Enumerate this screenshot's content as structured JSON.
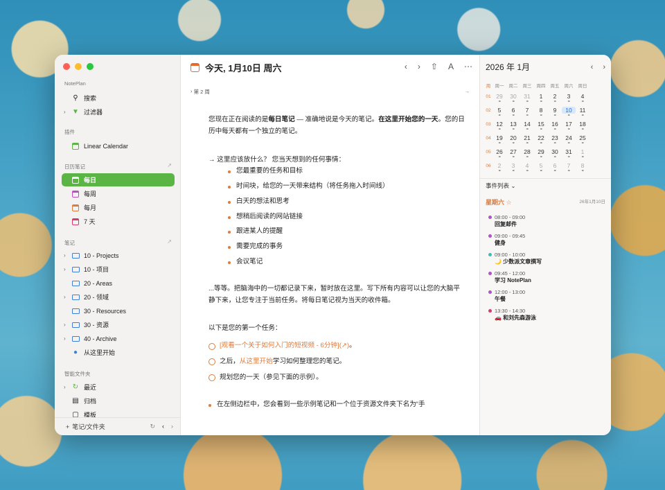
{
  "sidebar": {
    "app_name": "NotePlan",
    "search": "搜索",
    "filters": "过滤器",
    "plugins_label": "插件",
    "linear_calendar": "Linear Calendar",
    "calendar_notes_label": "日历笔记",
    "calendar_items": [
      "每日",
      "每周",
      "每月",
      "7 天"
    ],
    "notes_label": "笔记",
    "folders": [
      "10 - Projects",
      "10 - 项目",
      "20 - Areas",
      "20 - 领域",
      "30 - Resources",
      "30 - 资源",
      "40 - Archive",
      "从这里开始"
    ],
    "smart_folders_label": "智能文件夹",
    "smart_items": [
      "最近",
      "归档",
      "模板"
    ],
    "add_label": "笔记/文件夹"
  },
  "main": {
    "title": "今天, 1月10日 周六",
    "week": "第 2 周",
    "intro_1": "您现在正在阅读的是",
    "intro_bold_1": "每日笔记",
    "intro_2": " — 准确地说是今天的笔记。",
    "intro_bold_2": "在这里开始您的一天",
    "intro_3": "。您的日历中每天都有一个独立的笔记。",
    "question": "→ 这里应该放什么？ 您当天想到的任何事情：",
    "bullets": [
      "您最重要的任务和目标",
      "时间块，给您的一天带来结构（将任务拖入时间线）",
      "白天的想法和思考",
      "想稍后阅读的网站链接",
      "跟进某人的提醒",
      "需要完成的事务",
      "会议笔记"
    ],
    "paragraph": "...等等。把脑海中的一切都记录下来，暂时放在这里。写下所有内容可以让您的大脑平静下来，让您专注于当前任务。将每日笔记视为当天的收件箱。",
    "first_task_label": "以下是您的第一个任务：",
    "task1_link": "[观看一个关于如何入门的短视频 - 6分钟](↗)",
    "task1_end": "。",
    "task2_a": "之后，",
    "task2_link": "从这里开始",
    "task2_b": "学习如何整理您的笔记。",
    "task3": "规划您的一天（参见下面的示例）。",
    "last_line": "在左侧边栏中，您会看到一些示例笔记和一个位于资源文件夹下名为“手"
  },
  "calendar": {
    "month_title": "2026 年 1月",
    "weekday_headers": [
      "周一",
      "周二",
      "周三",
      "周四",
      "周五",
      "周六",
      "周日"
    ],
    "week_col_header": "周",
    "weeks": [
      {
        "wk": "01",
        "days": [
          "29",
          "30",
          "31",
          "1",
          "2",
          "3",
          "4"
        ]
      },
      {
        "wk": "02",
        "days": [
          "5",
          "6",
          "7",
          "8",
          "9",
          "10",
          "11"
        ]
      },
      {
        "wk": "03",
        "days": [
          "12",
          "13",
          "14",
          "15",
          "16",
          "17",
          "18"
        ]
      },
      {
        "wk": "04",
        "days": [
          "19",
          "20",
          "21",
          "22",
          "23",
          "24",
          "25"
        ]
      },
      {
        "wk": "05",
        "days": [
          "26",
          "27",
          "28",
          "29",
          "30",
          "31",
          "1"
        ]
      },
      {
        "wk": "06",
        "days": [
          "2",
          "3",
          "4",
          "5",
          "6",
          "7",
          "8"
        ]
      }
    ],
    "events_header": "事件列表 ⌄",
    "day_label": "星期六 ☆",
    "day_date": "26年1月10日",
    "events": [
      {
        "time": "08:00 - 09:00",
        "name": "回复邮件",
        "color": "#b052c9"
      },
      {
        "time": "09:00 - 09:45",
        "name": "健身",
        "color": "#b052c9"
      },
      {
        "time": "09:00 - 10:00",
        "name": "🌙 少数派文章撰写",
        "color": "#3dbbb8"
      },
      {
        "time": "09:45 - 12:00",
        "name": "学习 NotePlan",
        "color": "#b052c9"
      },
      {
        "time": "12:00 - 13:00",
        "name": "午餐",
        "color": "#b052c9"
      },
      {
        "time": "13:30 - 14:30",
        "name": "🚗 和刘先森游泳",
        "color": "#d83a6a"
      }
    ]
  },
  "colors": {
    "accent": "#5bb545",
    "orange": "#e07a3a",
    "today": "#d7e8fa"
  }
}
